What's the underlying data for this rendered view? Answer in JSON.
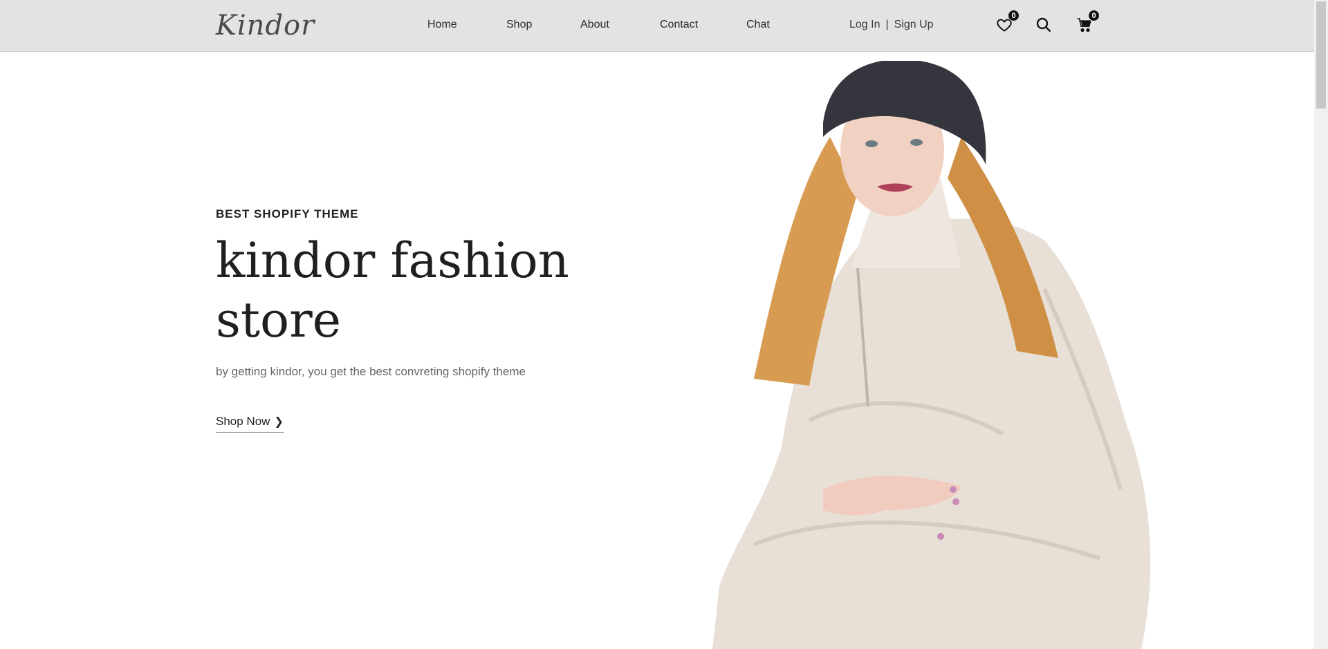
{
  "header": {
    "logo": "Kindor",
    "nav": [
      {
        "label": "Home"
      },
      {
        "label": "Shop"
      },
      {
        "label": "About"
      },
      {
        "label": "Contact"
      },
      {
        "label": "Chat"
      }
    ],
    "auth": {
      "login": "Log In",
      "separator": "|",
      "signup": "Sign Up"
    },
    "wishlist_count": "0",
    "cart_count": "0",
    "icons": [
      "heart-icon",
      "search-icon",
      "cart-icon"
    ]
  },
  "hero": {
    "eyebrow": "BEST SHOPIFY THEME",
    "headline_line1": "kindor fashion",
    "headline_line2": "store",
    "subline": "by getting kindor, you get the best convreting shopify theme",
    "cta_label": "Shop Now",
    "image": "model in beanie and puffer jacket"
  },
  "colors": {
    "header_bg": "#e3e3e3",
    "text_dark": "#1f1f1f",
    "text_muted": "#666666",
    "badge_bg": "#111111",
    "jacket": "#e8dfd6",
    "beanie": "#35353d",
    "hair": "#d79b52"
  }
}
